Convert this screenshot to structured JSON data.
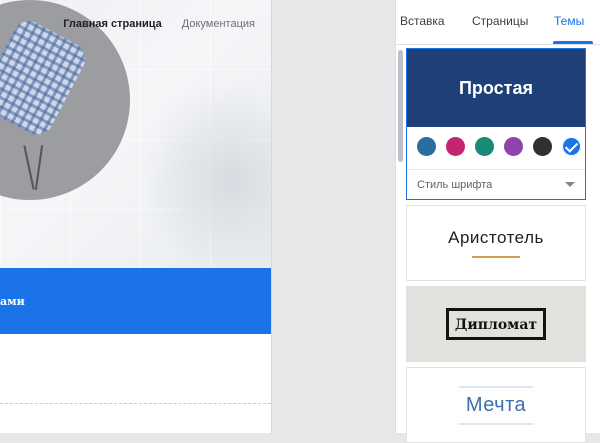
{
  "preview": {
    "nav": {
      "home_label": "Главная страница",
      "docs_label": "Документация"
    },
    "band_text": "ами"
  },
  "panel": {
    "tabs": [
      {
        "label": "Вставка"
      },
      {
        "label": "Страницы"
      },
      {
        "label": "Темы"
      }
    ],
    "active_tab": "Темы",
    "themes": {
      "simple": {
        "title": "Простая",
        "font_style_label": "Стиль шрифта",
        "swatches": [
          {
            "name": "steel-blue",
            "color": "#2a6d9e"
          },
          {
            "name": "magenta",
            "color": "#c4256e"
          },
          {
            "name": "teal",
            "color": "#1a8a78"
          },
          {
            "name": "purple",
            "color": "#8e44ad"
          },
          {
            "name": "charcoal",
            "color": "#2f3135"
          },
          {
            "name": "blue",
            "color": "#1a73e8",
            "selected": true
          }
        ]
      },
      "aristotle": {
        "title": "Аристотель"
      },
      "diplomat": {
        "title": "Дипломат"
      },
      "dream": {
        "title": "Мечта"
      }
    }
  },
  "colors": {
    "accent": "#1a73e8",
    "simple_header": "#1f3f78"
  }
}
